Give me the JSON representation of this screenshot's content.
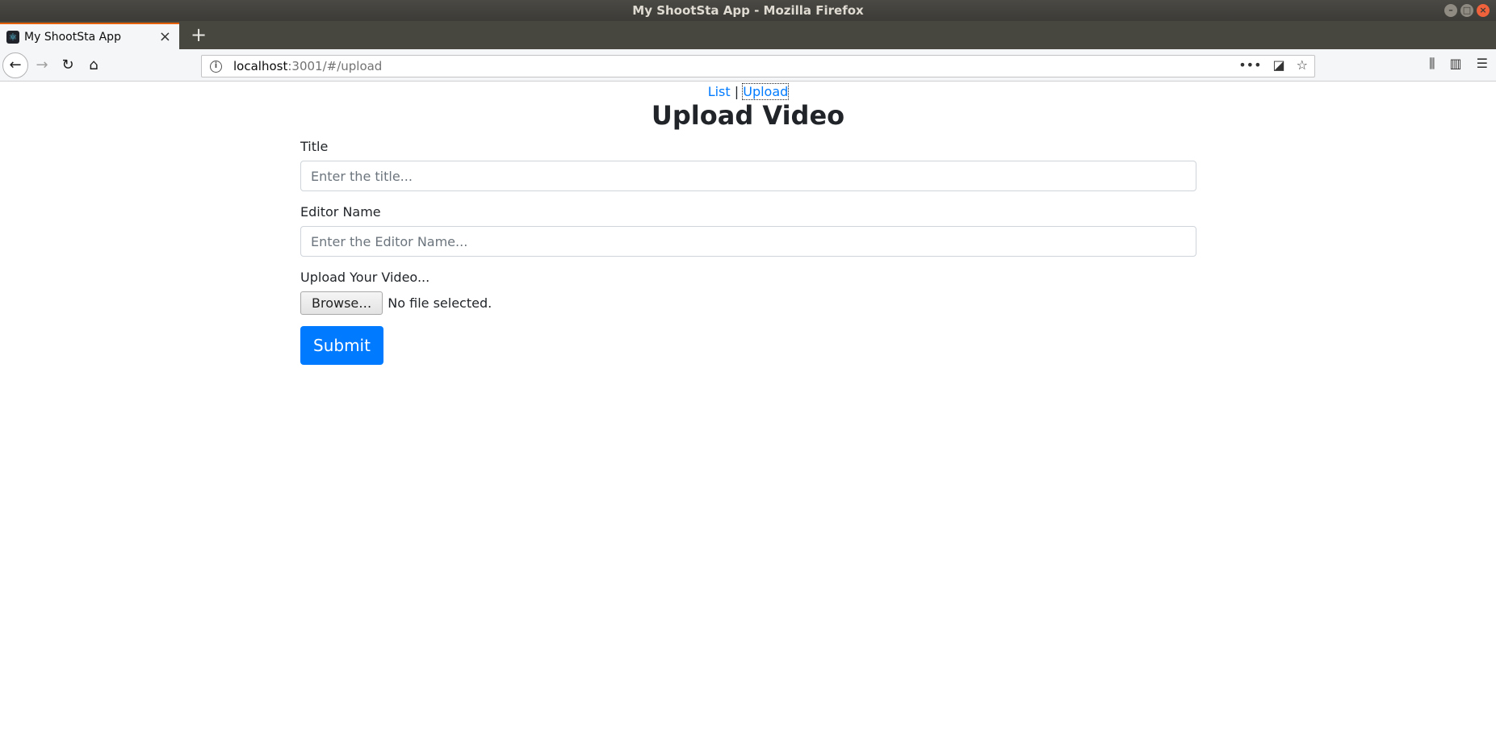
{
  "window": {
    "title": "My ShootSta App - Mozilla Firefox",
    "minimize": "–",
    "maximize": "□",
    "close": "×"
  },
  "tabs": [
    {
      "title": "My ShootSta App",
      "favicon": "react-icon"
    }
  ],
  "browser": {
    "url_host": "localhost",
    "url_rest": ":3001/#/upload",
    "new_tab": "+"
  },
  "nav": {
    "list_label": "List",
    "separator": "|",
    "upload_label": "Upload"
  },
  "page": {
    "title": "Upload Video"
  },
  "form": {
    "title_label": "Title",
    "title_placeholder": "Enter the title...",
    "title_value": "",
    "editor_label": "Editor Name",
    "editor_placeholder": "Enter the Editor Name...",
    "editor_value": "",
    "upload_label": "Upload Your Video...",
    "browse_label": "Browse…",
    "file_status": "No file selected.",
    "submit_label": "Submit"
  },
  "colors": {
    "link": "#007bff",
    "primary_button": "#007bff",
    "tab_accent": "#e66000"
  }
}
